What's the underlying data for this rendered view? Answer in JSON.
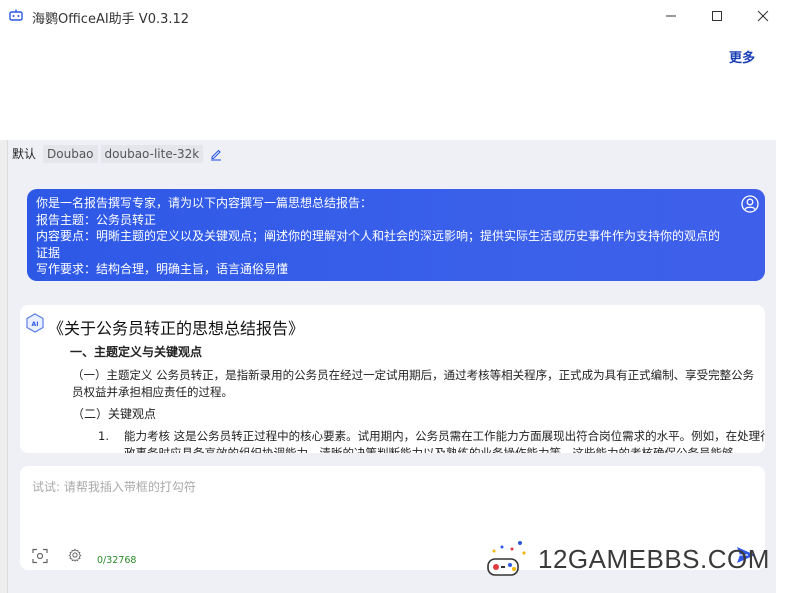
{
  "window": {
    "title": "海鹦OfficeAI助手 V0.3.12"
  },
  "header": {
    "more_label": "更多"
  },
  "tabs": [
    {
      "label": "默认"
    },
    {
      "label": "Doubao"
    },
    {
      "label": "doubao-lite-32k"
    }
  ],
  "user_message": {
    "lines": [
      "你是一名报告撰写专家，请为以下内容撰写一篇思想总结报告：",
      "报告主题：公务员转正",
      "内容要点：明晰主题的定义以及关键观点；阐述你的理解对个人和社会的深远影响；提供实际生活或历史事件作为支持你的观点的证据",
      "写作要求：结构合理，明确主旨，语言通俗易懂"
    ]
  },
  "answer": {
    "title": "《关于公务员转正的思想总结报告》",
    "h1": "一、主题定义与关键观点",
    "p1": "（一）主题定义 公务员转正，是指新录用的公务员在经过一定试用期后，通过考核等相关程序，正式成为具有正式编制、享受完整公务员权益并承担相应责任的过程。",
    "h2": "（二）关键观点",
    "item1_num": "1.",
    "item1_text": "能力考核 这是公务员转正过程中的核心要素。试用期内，公务员需在工作能力方面展现出符合岗位需求的水平。例如，在处理行政事务时应具备高效的组织协调能力、清晰的决策判断能力以及熟练的业务操作能力等。这些能力的考核确保公务员能够"
  },
  "input": {
    "placeholder": "试试: 请帮我插入带框的打勾符",
    "value": "",
    "counter": "0/32768"
  },
  "watermark": {
    "text": "12GAMEBBS.COM"
  },
  "colors": {
    "accent": "#2d58e6",
    "link": "#1a3fb5",
    "counter": "#2a8a2a",
    "panel_bg": "#eef0f5"
  }
}
